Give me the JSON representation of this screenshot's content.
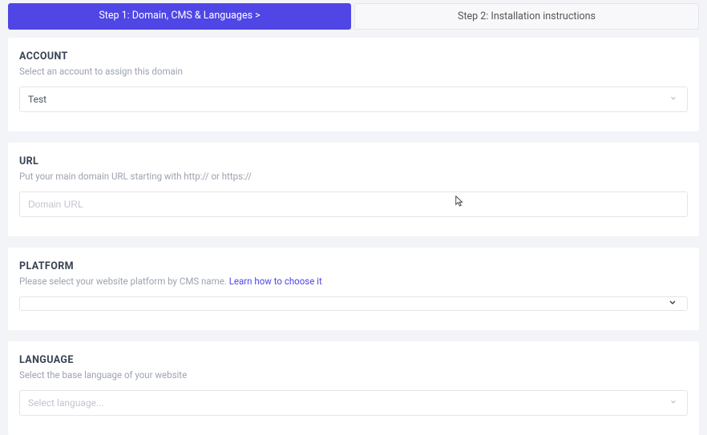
{
  "steps": {
    "step1": "Step 1: Domain, CMS & Languages  >",
    "step2": "Step 2: Installation instructions"
  },
  "account": {
    "title": "ACCOUNT",
    "desc": "Select an account to assign this domain",
    "value": "Test"
  },
  "url": {
    "title": "URL",
    "desc": "Put your main domain URL starting with http:// or https://",
    "placeholder": "Domain URL"
  },
  "platform": {
    "title": "PLATFORM",
    "desc_prefix": "Please select your website platform by CMS name.  ",
    "link": "Learn how to choose it",
    "value": ""
  },
  "language": {
    "title": "LANGUAGE",
    "desc": "Select the base language of your website",
    "value": "Select language..."
  }
}
